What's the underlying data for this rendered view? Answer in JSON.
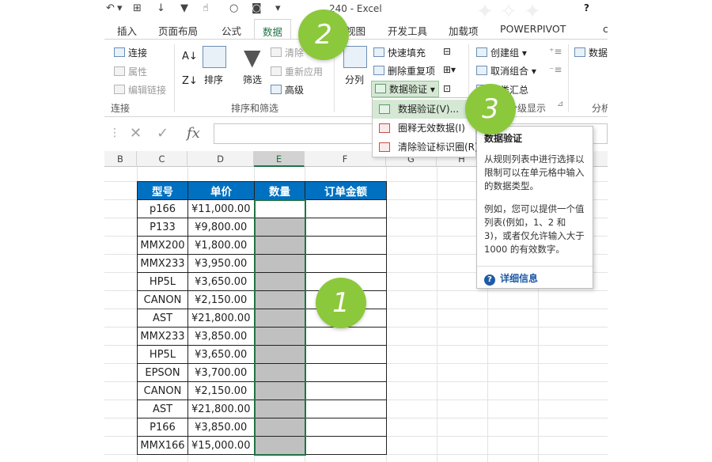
{
  "window": {
    "title": "240 - Excel",
    "help": "?"
  },
  "tabs": [
    {
      "label": "插入"
    },
    {
      "label": "页面布局"
    },
    {
      "label": "公式"
    },
    {
      "label": "数据"
    },
    {
      "label": "视图"
    },
    {
      "label": "开发工具"
    },
    {
      "label": "加载项"
    },
    {
      "label": "POWERPIVOT"
    },
    {
      "label": "c"
    }
  ],
  "ribbon": {
    "connections": {
      "connect": "连接",
      "properties": "属性",
      "edit_links": "编辑链接",
      "group": "连接"
    },
    "sort_filter": {
      "sort": "排序",
      "filter": "筛选",
      "clear": "清除",
      "reapply": "重新应用",
      "advanced": "高级",
      "group": "排序和筛选"
    },
    "data_tools": {
      "split": "分列",
      "flash_fill": "快速填充",
      "remove_dup": "删除重复项",
      "validation": "数据验证"
    },
    "outline": {
      "group_btn": "创建组",
      "ungroup": "取消组合",
      "subtotal": "分类汇总",
      "group": "分级显示"
    },
    "analysis": {
      "data": "数据",
      "group": "分析"
    }
  },
  "validation_menu": [
    {
      "label": "数据验证(V)..."
    },
    {
      "label": "圈释无效数据(I)"
    },
    {
      "label": "清除验证标识圈(R)"
    }
  ],
  "tooltip": {
    "title": "数据验证",
    "p1": "从规则列表中进行选择以限制可以在单元格中输入的数据类型。",
    "p2": "例如，您可以提供一个值列表(例如，1、2 和 3)，或者仅允许输入大于 1000 的有效数字。",
    "more": "详细信息"
  },
  "columns": [
    "B",
    "C",
    "D",
    "E",
    "F",
    "G",
    "H"
  ],
  "table": {
    "headers": [
      "型号",
      "单价",
      "数量",
      "订单金额"
    ],
    "rows": [
      [
        "p166",
        "¥11,000.00"
      ],
      [
        "P133",
        "¥9,800.00"
      ],
      [
        "MMX200",
        "¥1,800.00"
      ],
      [
        "MMX233",
        "¥3,950.00"
      ],
      [
        "HP5L",
        "¥3,650.00"
      ],
      [
        "CANON",
        "¥2,150.00"
      ],
      [
        "AST",
        "¥21,800.00"
      ],
      [
        "MMX233",
        "¥3,850.00"
      ],
      [
        "HP5L",
        "¥3,650.00"
      ],
      [
        "EPSON",
        "¥3,700.00"
      ],
      [
        "CANON",
        "¥2,150.00"
      ],
      [
        "AST",
        "¥21,800.00"
      ],
      [
        "P166",
        "¥3,850.00"
      ],
      [
        "MMX166",
        "¥15,000.00"
      ]
    ]
  },
  "steps": [
    "1",
    "2",
    "3"
  ],
  "colors": {
    "accent": "#217346",
    "header_fill": "#0070c0",
    "step": "#8cc83c",
    "selected_fill": "#c0c0c0"
  }
}
